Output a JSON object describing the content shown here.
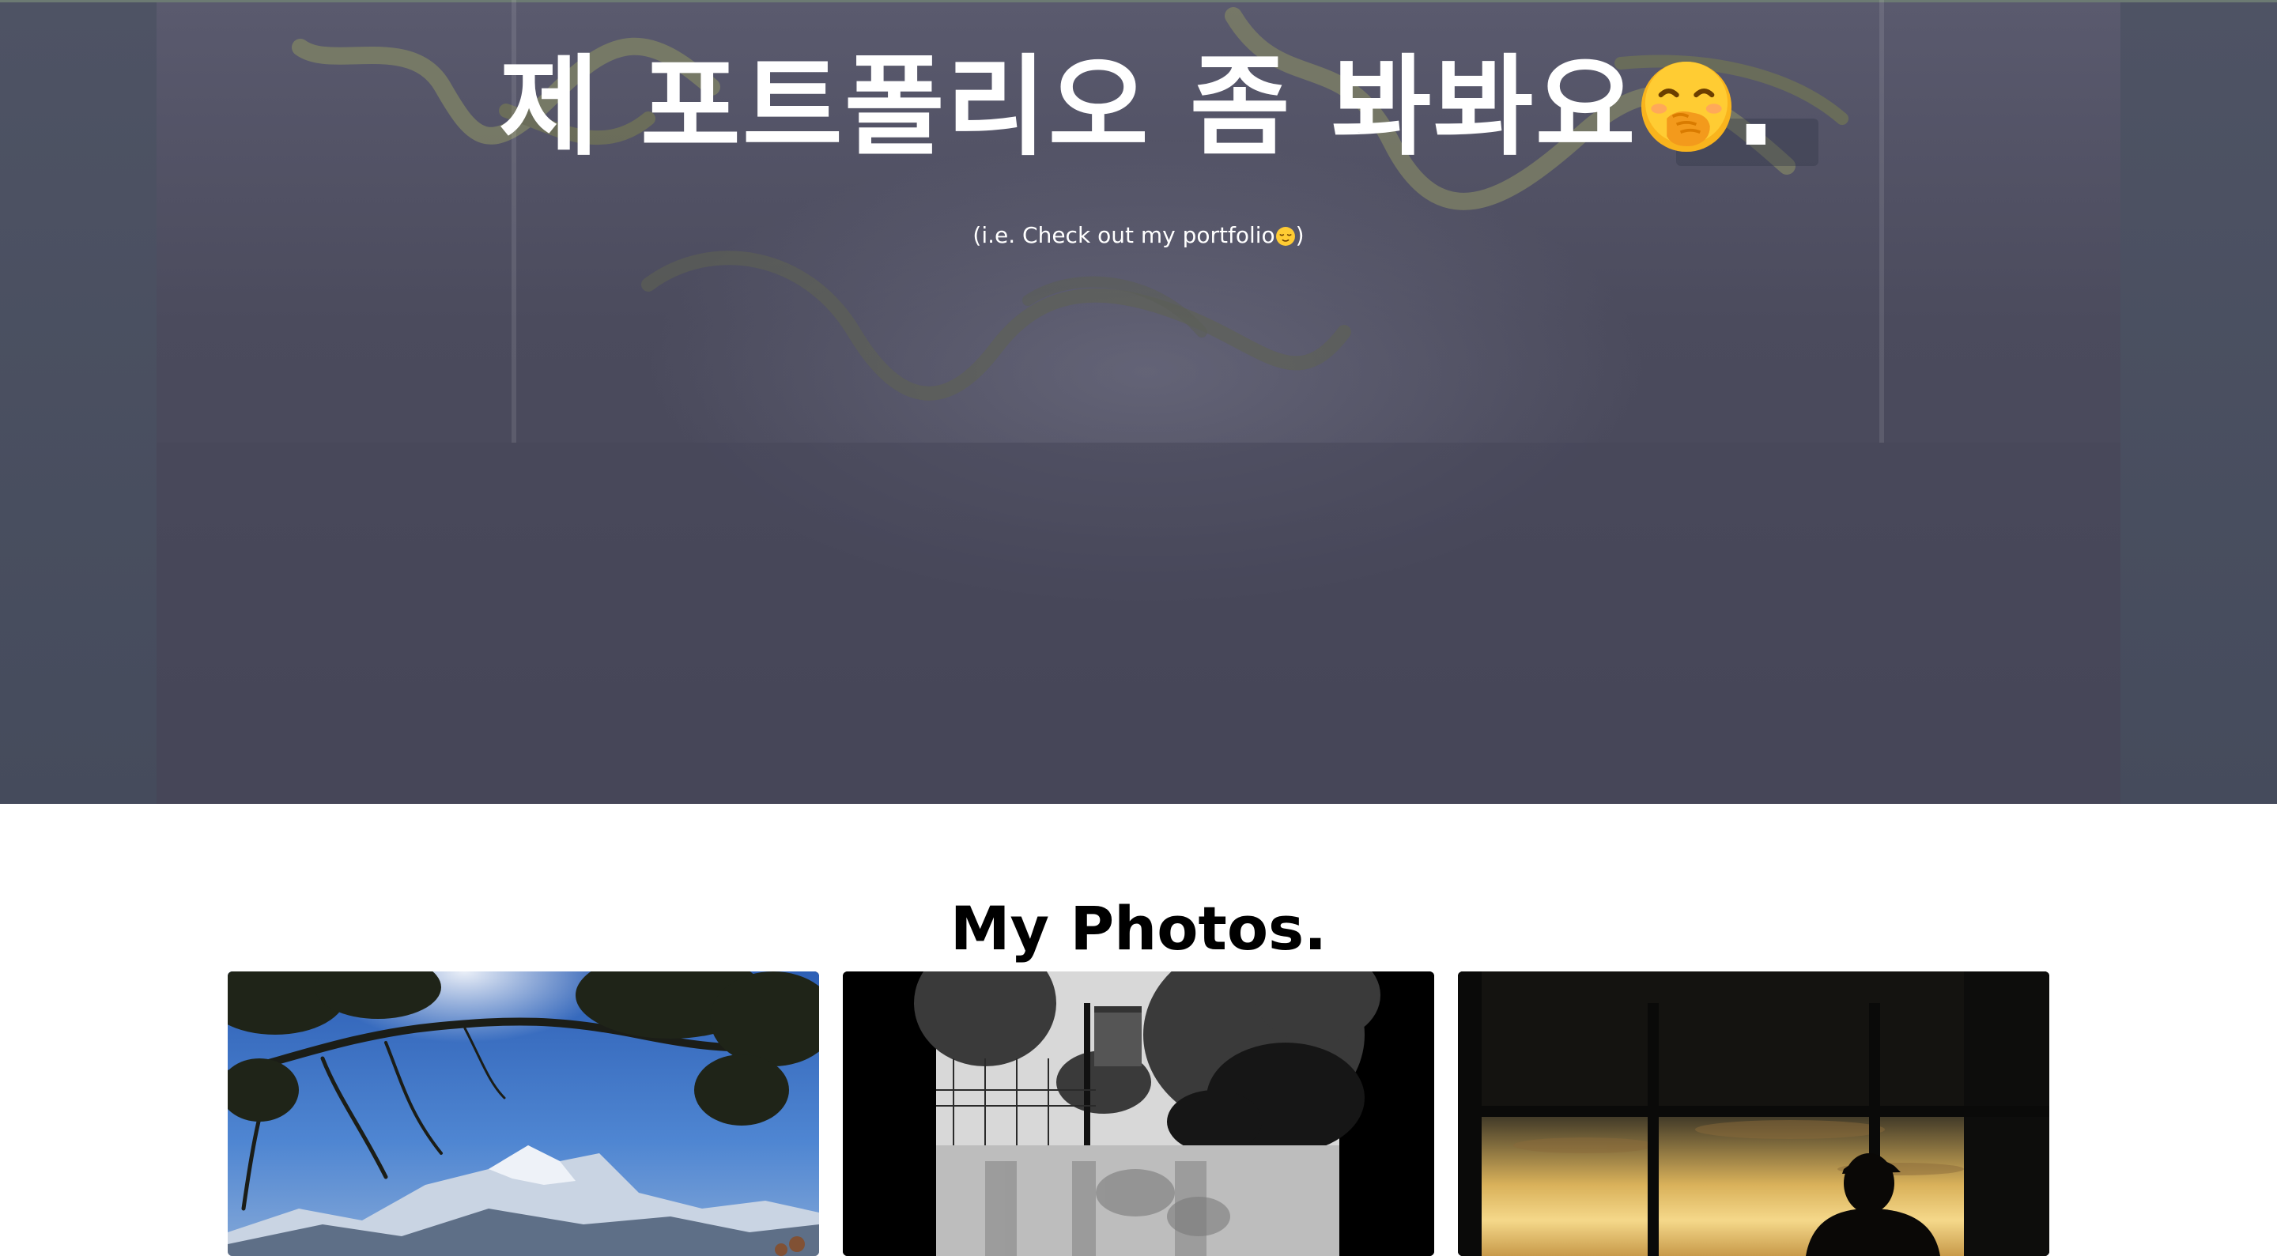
{
  "hero": {
    "title": "제 포트폴리오 좀 봐봐요",
    "title_emoji": "face-with-hand-over-mouth-emoji",
    "title_end": ".",
    "subtitle_start": "(i.e. Check out my portfolio",
    "subtitle_emoji": "relieved-face-emoji",
    "subtitle_end": ")"
  },
  "photos": {
    "heading": "My Photos.",
    "items": [
      {
        "subject": "mountain-landscape-with-tree-branches"
      },
      {
        "subject": "black-and-white-building-and-trees"
      },
      {
        "subject": "silhouette-at-window-sunset"
      }
    ]
  },
  "colors": {
    "hero_overlay": "#4b4b5d",
    "text_on_hero": "#ffffff",
    "heading": "#000000",
    "page_background": "#ffffff"
  }
}
